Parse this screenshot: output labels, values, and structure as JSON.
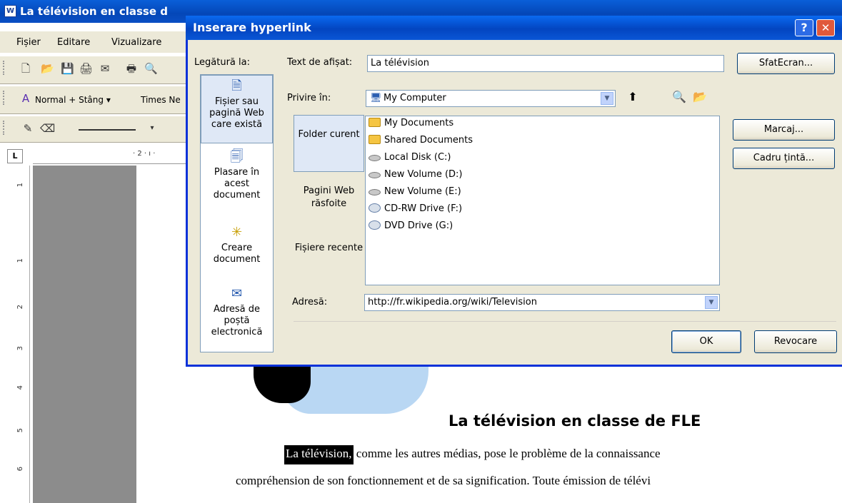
{
  "word": {
    "title": "La télévision en classe d",
    "app_icon": "W",
    "menus": [
      "Fișier",
      "Editare",
      "Vizualizare"
    ],
    "style_box": "Normal + Stâng",
    "font_box": "Times Ne",
    "ruler_corner": "L",
    "hruler_text": "· 2 · ı ·",
    "vruler_numbers": [
      "1",
      "1",
      "2",
      "3",
      "4",
      "5",
      "6"
    ]
  },
  "document": {
    "heading": "La télévision en classe de FLE",
    "p1_selected": "La télévision,",
    "p1_rest": " comme les autres médias, pose le problème de la connaissance",
    "p2": "compréhension de son fonctionnement et de  sa  signification. Toute émission de télévi"
  },
  "dialog": {
    "title": "Inserare hyperlink",
    "help_label": "?",
    "close_label": "✕",
    "link_to_label": "Legătură la:",
    "link_to_items": [
      {
        "label": "Fișier sau pagină Web care există",
        "icon": "web-page-icon"
      },
      {
        "label": "Plasare în acest document",
        "icon": "document-place-icon"
      },
      {
        "label": "Creare document",
        "icon": "new-document-icon"
      },
      {
        "label": "Adresă de poștă electronică",
        "icon": "email-icon"
      }
    ],
    "display_text_label": "Text de afișat:",
    "display_text_value": "La télévision",
    "screentip_button": "SfatEcran...",
    "look_in_label": "Privire în:",
    "look_in_value": "My Computer",
    "folder_items": [
      "Folder curent",
      "Pagini Web răsfoite",
      "Fișiere recente"
    ],
    "files": [
      {
        "name": "My Documents",
        "icon": "folder-icon"
      },
      {
        "name": "Shared Documents",
        "icon": "folder-icon"
      },
      {
        "name": "Local Disk (C:)",
        "icon": "disk-icon"
      },
      {
        "name": "New Volume (D:)",
        "icon": "disk-icon"
      },
      {
        "name": "New Volume (E:)",
        "icon": "disk-icon"
      },
      {
        "name": "CD-RW Drive (F:)",
        "icon": "cd-drive-icon"
      },
      {
        "name": "DVD Drive (G:)",
        "icon": "cd-drive-icon"
      }
    ],
    "address_label": "Adresă:",
    "address_value": "http://fr.wikipedia.org/wiki/Television",
    "bookmark_button": "Marcaj...",
    "target_frame_button": "Cadru țintă...",
    "ok_button": "OK",
    "cancel_button": "Revocare"
  }
}
